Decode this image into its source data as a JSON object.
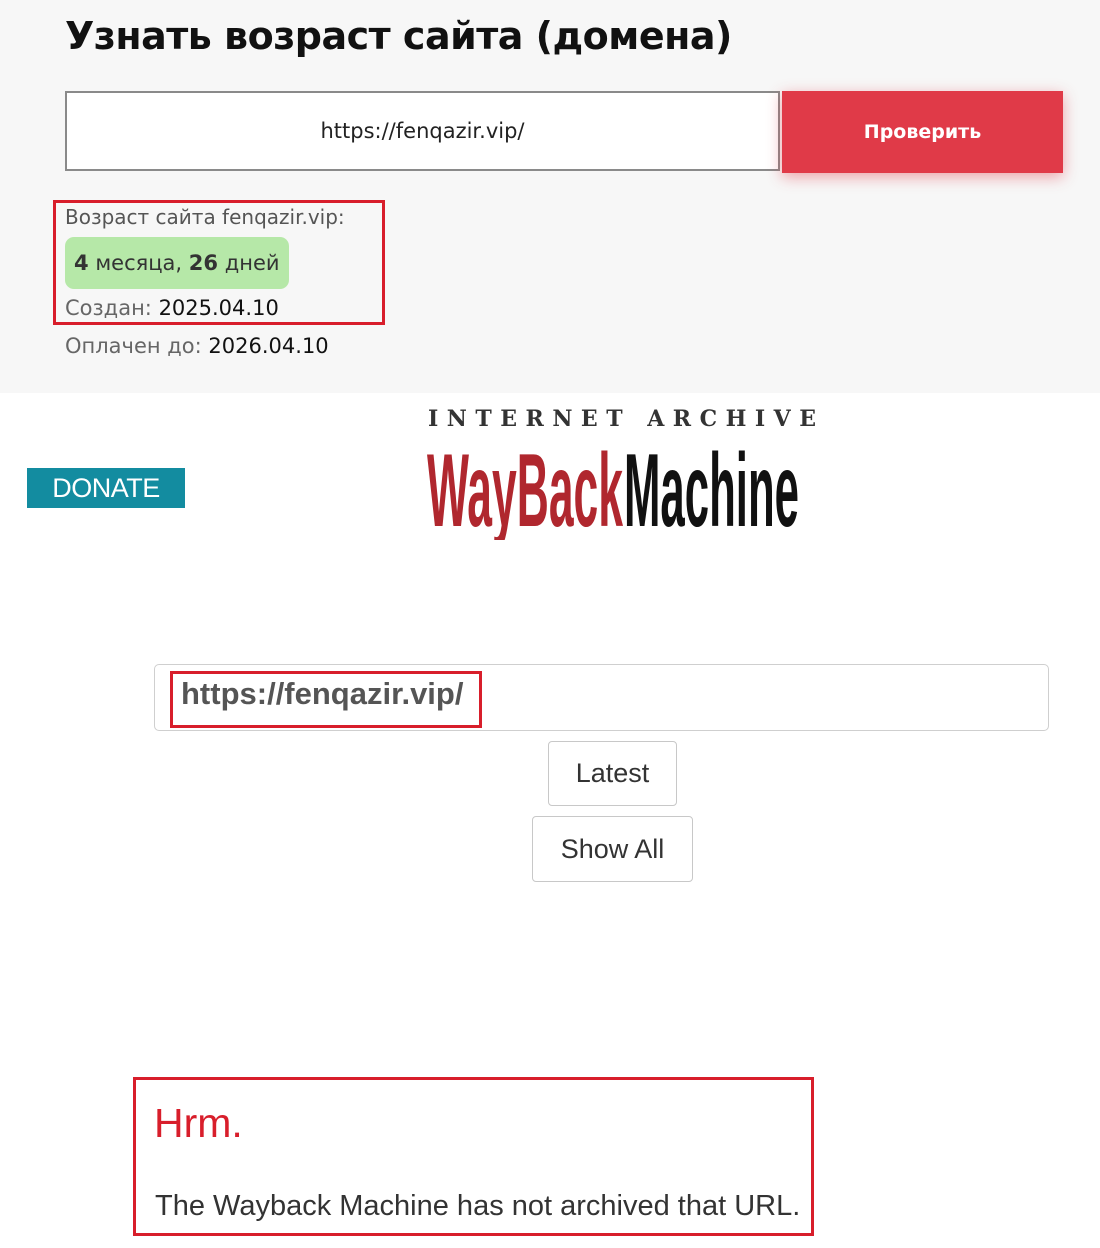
{
  "checker": {
    "title": "Узнать возраст сайта (домена)",
    "url_value": "https://fenqazir.vip/",
    "check_button": "Проверить",
    "age_label": "Возраст сайта fenqazir.vip:",
    "age_months_num": "4",
    "age_months_word": "месяца,",
    "age_days_num": "26",
    "age_days_word": "дней",
    "created_label": "Создан:",
    "created_value": "2025.04.10",
    "paid_label": "Оплачен до:",
    "paid_value": "2026.04.10"
  },
  "wayback": {
    "caption": "INTERNET ARCHIVE",
    "logo_text": "WayBackMachine",
    "donate": "DONATE",
    "search_value": "https://fenqazir.vip/",
    "latest_button": "Latest",
    "show_all_button": "Show All",
    "error_title": "Hrm.",
    "error_message": "The Wayback Machine has not archived that URL."
  },
  "colors": {
    "accent_red": "#e03a48",
    "highlight_red": "#d81e2b",
    "badge_green": "#b6e8a8",
    "donate_teal": "#138ca0",
    "logo_red": "#b0272e"
  }
}
